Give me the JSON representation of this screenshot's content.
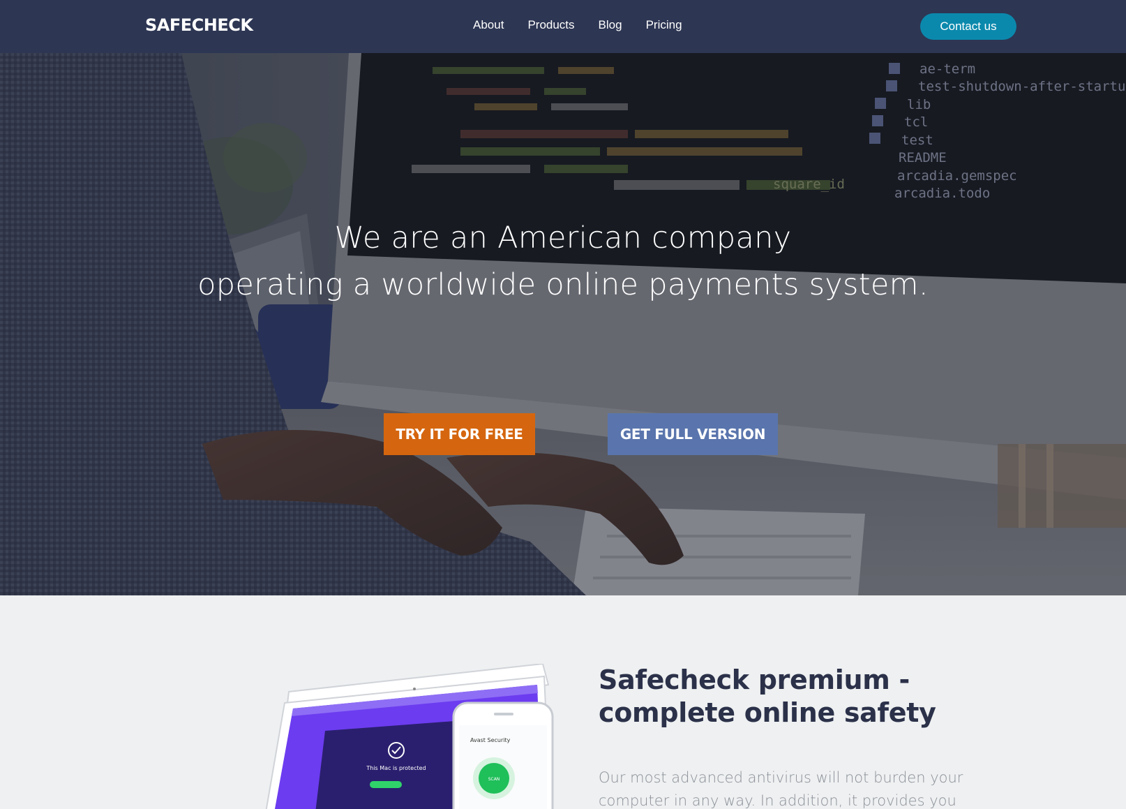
{
  "brand": {
    "name": "SAFECHECK"
  },
  "nav": {
    "links": [
      "About",
      "Products",
      "Blog",
      "Pricing"
    ],
    "contact_label": "Contact us"
  },
  "hero": {
    "line1": "We are an American company",
    "line2": "operating a worldwide online payments system.",
    "btn_try": "TRY IT FOR FREE",
    "btn_full": "GET FULL VERSION",
    "code_lines": [
      "ae-term",
      "test-shutdown-after-startup",
      "lib",
      "tcl",
      "test",
      "README",
      "arcadia.gemspec",
      "arcadia.todo",
      "square_id"
    ]
  },
  "premium": {
    "title_line1": "Safecheck premium -",
    "title_line2": "complete online safety",
    "text": "Our most advanced antivirus will not burden your computer in any way. In addition, it provides you",
    "laptop_screen_text": "This Mac is protected",
    "phone_app_title": "Avast Security",
    "phone_scan_label": "SCAN"
  },
  "colors": {
    "navbar": "#2d3653",
    "contact": "#0b89ad",
    "try": "#d5660f",
    "full": "#5a75ad",
    "section_bg": "#eef0f1",
    "laptop_screen": "#6c3cf0"
  }
}
